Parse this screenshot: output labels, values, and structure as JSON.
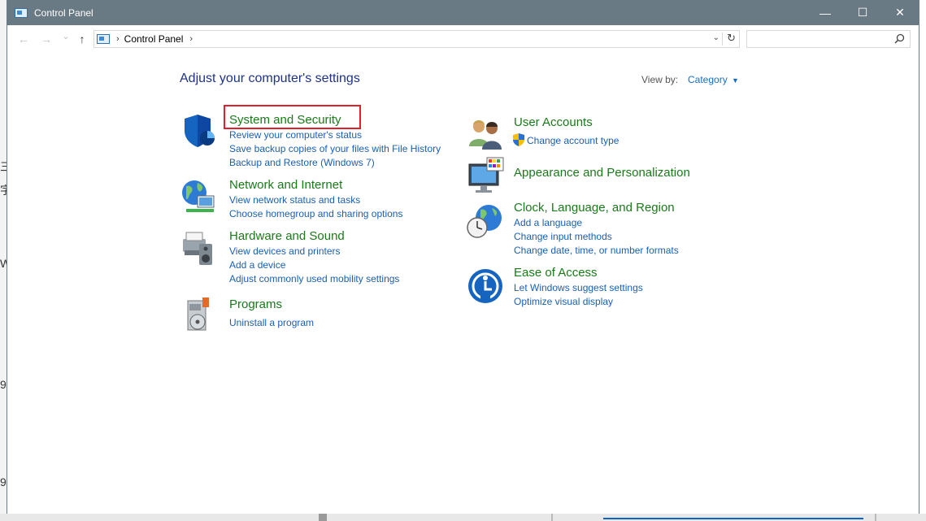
{
  "window": {
    "title": "Control Panel"
  },
  "background": {
    "left_glyphs": [
      "三",
      "字",
      "W",
      "9",
      "9"
    ]
  },
  "titlebar": {
    "minimize_glyph": "—",
    "maximize_glyph": "☐",
    "close_glyph": "✕"
  },
  "nav": {
    "back_glyph": "←",
    "forward_glyph": "→",
    "recent_glyph": "⌄",
    "up_glyph": "↑"
  },
  "address": {
    "crumbs": [
      "Control Panel"
    ],
    "separator": "›",
    "dropdown_glyph": "⌄",
    "refresh_glyph": "↻"
  },
  "search": {
    "placeholder": ""
  },
  "main": {
    "heading": "Adjust your computer's settings",
    "view_by_label": "View by:",
    "view_by_value": "Category",
    "view_by_arrow": "▼"
  },
  "categories": [
    {
      "title": "System and Security",
      "icon": "shield-icon",
      "links": [
        "Review your computer's status",
        "Save backup copies of your files with File History",
        "Backup and Restore (Windows 7)"
      ]
    },
    {
      "title": "Network and Internet",
      "icon": "network-globe-icon",
      "links": [
        "View network status and tasks",
        "Choose homegroup and sharing options"
      ]
    },
    {
      "title": "Hardware and Sound",
      "icon": "printer-speaker-icon",
      "links": [
        "View devices and printers",
        "Add a device",
        "Adjust commonly used mobility settings"
      ]
    },
    {
      "title": "Programs",
      "icon": "programs-disc-icon",
      "links": [
        "Uninstall a program"
      ]
    },
    {
      "title": "User Accounts",
      "icon": "users-icon",
      "links": [
        "Change account type"
      ]
    },
    {
      "title": "Appearance and Personalization",
      "icon": "monitor-palette-icon",
      "links": []
    },
    {
      "title": "Clock, Language, and Region",
      "icon": "clock-globe-icon",
      "links": [
        "Add a language",
        "Change input methods",
        "Change date, time, or number formats"
      ]
    },
    {
      "title": "Ease of Access",
      "icon": "ease-of-access-icon",
      "links": [
        "Let Windows suggest settings",
        "Optimize visual display"
      ]
    }
  ],
  "colors": {
    "titlebar": "#6a7a84",
    "category_title": "#1a7a1a",
    "link": "#1a5fb4",
    "heading": "#1e3287",
    "highlight": "#e0202a"
  }
}
